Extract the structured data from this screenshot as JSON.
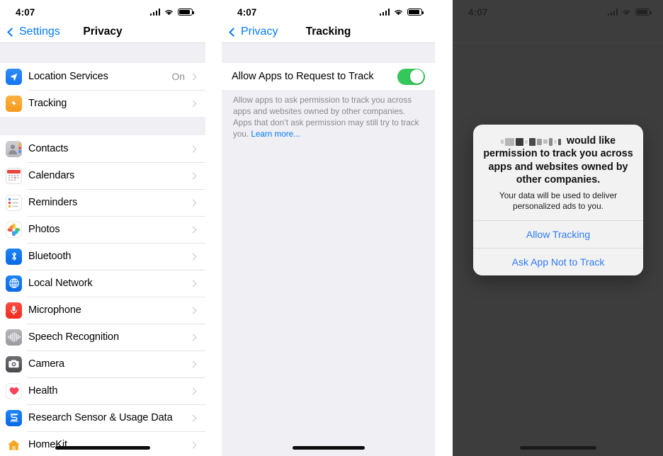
{
  "panel_privacy": {
    "status_bar": {
      "time": "4:07",
      "signal_icon": "cellular-signal-icon",
      "wifi_icon": "wifi-icon",
      "battery_icon": "battery-icon"
    },
    "nav": {
      "back_label": "Settings",
      "title": "Privacy",
      "back_icon": "chevron-left-icon"
    },
    "groups": [
      {
        "rows": [
          {
            "label": "Location Services",
            "value": "On",
            "icon": "location-arrow-icon"
          },
          {
            "label": "Tracking",
            "value": "",
            "icon": "tracking-icon"
          }
        ]
      },
      {
        "rows": [
          {
            "label": "Contacts",
            "value": "",
            "icon": "contacts-icon"
          },
          {
            "label": "Calendars",
            "value": "",
            "icon": "calendar-icon"
          },
          {
            "label": "Reminders",
            "value": "",
            "icon": "reminders-icon"
          },
          {
            "label": "Photos",
            "value": "",
            "icon": "photos-icon"
          },
          {
            "label": "Bluetooth",
            "value": "",
            "icon": "bluetooth-icon"
          },
          {
            "label": "Local Network",
            "value": "",
            "icon": "local-network-icon"
          },
          {
            "label": "Microphone",
            "value": "",
            "icon": "microphone-icon"
          },
          {
            "label": "Speech Recognition",
            "value": "",
            "icon": "speech-recognition-icon"
          },
          {
            "label": "Camera",
            "value": "",
            "icon": "camera-icon"
          },
          {
            "label": "Health",
            "value": "",
            "icon": "health-heart-icon"
          },
          {
            "label": "Research Sensor & Usage Data",
            "value": "",
            "icon": "research-sensor-icon"
          },
          {
            "label": "HomeKit",
            "value": "",
            "icon": "homekit-icon"
          }
        ]
      }
    ]
  },
  "panel_tracking": {
    "status_bar": {
      "time": "4:07"
    },
    "nav": {
      "back_label": "Privacy",
      "title": "Tracking",
      "back_icon": "chevron-left-icon"
    },
    "toggle": {
      "label": "Allow Apps to Request to Track",
      "state": "on",
      "accent_color": "#34c759"
    },
    "footnote": {
      "text": "Allow apps to ask permission to track you across apps and websites owned by other companies. Apps that don’t ask permission may still try to track you. ",
      "link_label": "Learn more...",
      "link_color": "#007aff"
    }
  },
  "panel_prompt": {
    "status_bar": {
      "time": "4:07"
    },
    "dialog": {
      "app_name_redacted": "[redacted app name]",
      "title_rest": " would like permission to track you across apps and websites owned by other companies.",
      "subtitle": "Your data will be used to deliver personalized ads to you.",
      "buttons": [
        {
          "label": "Allow Tracking"
        },
        {
          "label": "Ask App Not to Track"
        }
      ],
      "button_color": "#2f7bf6"
    },
    "overlay_color": "#3d3d3d"
  }
}
